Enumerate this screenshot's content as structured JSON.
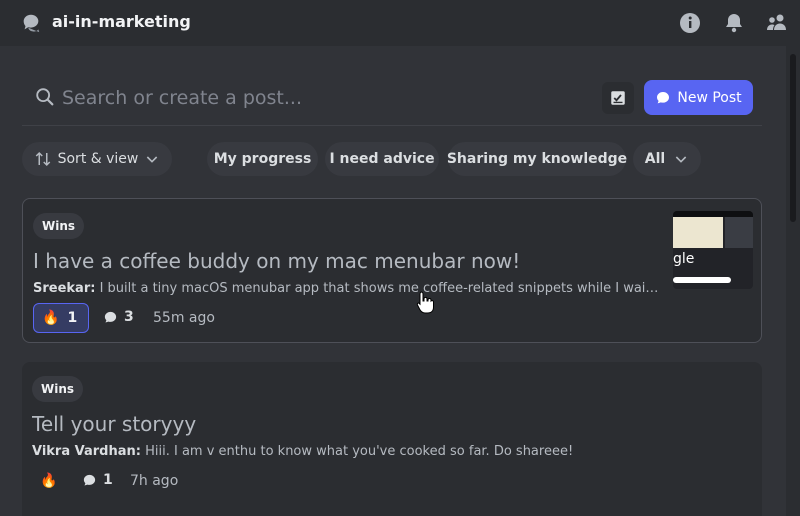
{
  "header": {
    "channel_name": "ai-in-marketing",
    "icons": [
      "forum-channel-icon",
      "info-icon",
      "bell-icon",
      "members-icon"
    ]
  },
  "search": {
    "placeholder": "Search or create a post...",
    "new_post_label": "New Post"
  },
  "filters": {
    "sort_label": "Sort & view",
    "chips": [
      "My progress",
      "I need advice",
      "Sharing my knowledge",
      "All"
    ]
  },
  "posts": [
    {
      "tag": "Wins",
      "title": "I have a coffee buddy on my mac menubar now!",
      "author": "Sreekar:",
      "snippet": "I built a tiny macOS menubar app that shows me coffee-related snippets while I wait f...",
      "reaction_emoji": "🔥",
      "reaction_count": "1",
      "comment_count": "3",
      "age": "55m ago",
      "thumbnail_text": "gle"
    },
    {
      "tag": "Wins",
      "title": "Tell your storyyy",
      "author": "Vikra Vardhan:",
      "snippet": "Hiii. I am v enthu to know what you've cooked so far. Do shareee!",
      "reaction_emoji": "🔥",
      "comment_count": "1",
      "age": "7h ago"
    }
  ],
  "colors": {
    "accent": "#5865f2",
    "background": "#313338",
    "card": "#2b2d31"
  }
}
